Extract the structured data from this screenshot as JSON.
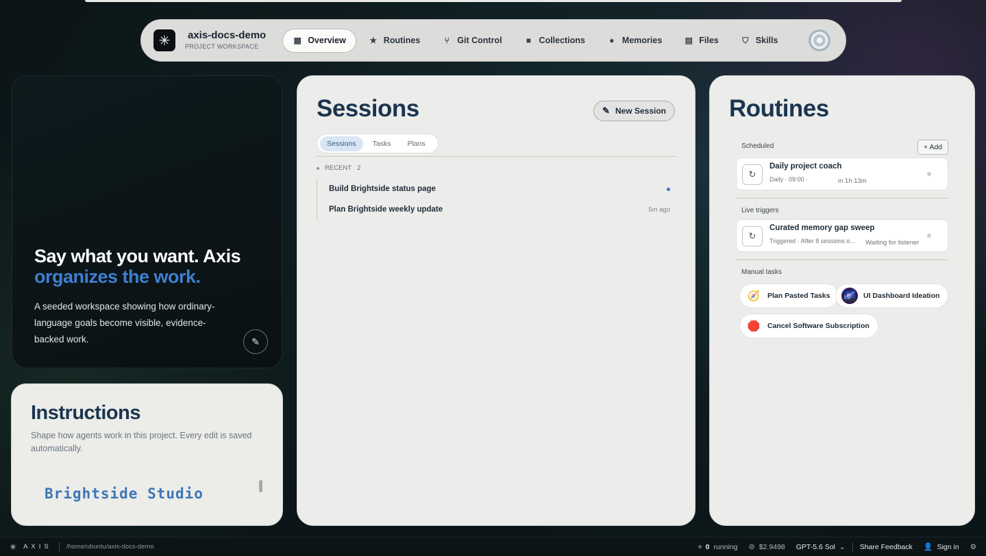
{
  "nav": {
    "project_name": "axis-docs-demo",
    "project_sub": "PROJECT WORKSPACE",
    "tabs": [
      {
        "label": "Overview",
        "icon": "grid-icon"
      },
      {
        "label": "Routines",
        "icon": "star-icon"
      },
      {
        "label": "Git Control",
        "icon": "git-branch-icon"
      },
      {
        "label": "Collections",
        "icon": "folder-icon"
      },
      {
        "label": "Memories",
        "icon": "brain-icon"
      },
      {
        "label": "Files",
        "icon": "file-icon"
      },
      {
        "label": "Skills",
        "icon": "shield-check-icon"
      }
    ]
  },
  "hero": {
    "title_line1": "Say what you want. Axis",
    "title_line2": "organizes the work.",
    "description": "A seeded workspace showing how ordinary-language goals become visible, evidence-backed work."
  },
  "instructions": {
    "title": "Instructions",
    "description": "Shape how agents work in this project. Every edit is saved automatically.",
    "preview": "Brightside Studio"
  },
  "sessions": {
    "title": "Sessions",
    "new_label": "New Session",
    "segments": [
      "Sessions",
      "Tasks",
      "Plans"
    ],
    "recent_label": "RECENT",
    "recent_count": "2",
    "items": [
      {
        "title": "Build Brightside status page",
        "meta": ""
      },
      {
        "title": "Plan Brightside weekly update",
        "meta": "5m ago"
      }
    ]
  },
  "routines": {
    "title": "Routines",
    "scheduled_label": "Scheduled",
    "add_label": "+ Add",
    "scheduled": {
      "title": "Daily project coach",
      "meta": "Daily · 09:00 ·",
      "when": "in 1h 13m"
    },
    "live_label": "Live triggers",
    "live": {
      "title": "Curated memory gap sweep",
      "meta": "Triggered · After 8 sessions o...",
      "when": "Waiting for listener"
    },
    "manual_label": "Manual tasks",
    "manual": [
      {
        "label": "Plan Pasted Tasks",
        "emoji": "🧭"
      },
      {
        "label": "UI Dashboard Ideation",
        "emoji": "🌌"
      },
      {
        "label": "Cancel Software Subscription",
        "emoji": "🛑"
      }
    ]
  },
  "statusbar": {
    "brand": "AXIS",
    "path": "/home/ubuntu/axis-docs-demo",
    "running_count": "0",
    "running_label": "running",
    "cost": "$2.9498",
    "model": "GPT-5.6 Sol",
    "feedback": "Share Feedback",
    "signin": "Sign in"
  },
  "colors": {
    "accent": "#3f7fd0",
    "heading": "#1b3550"
  }
}
